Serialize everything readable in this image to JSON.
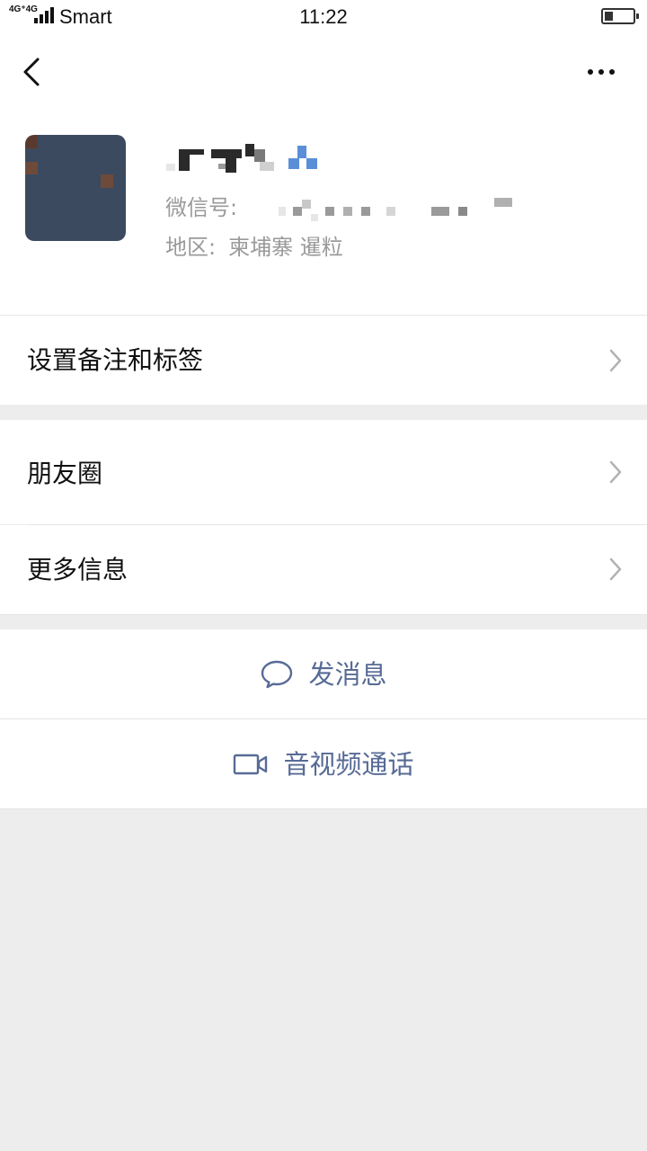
{
  "status_bar": {
    "network": "4G⁺4G",
    "carrier": "Smart",
    "time": "11:22",
    "battery_level": 0.3
  },
  "nav": {
    "back_icon": "chevron-left-icon",
    "more_icon": "more-dots-icon"
  },
  "profile": {
    "wechat_id_label": "微信号:",
    "region_label": "地区:",
    "region_value": "柬埔寨  暹粒"
  },
  "menu": {
    "remark_tags": "设置备注和标签",
    "moments": "朋友圈",
    "more_info": "更多信息"
  },
  "actions": {
    "send_message": "发消息",
    "video_call": "音视频通话"
  },
  "colors": {
    "link": "#576b95",
    "background": "#ededed",
    "text_secondary": "#9a9a9a"
  }
}
